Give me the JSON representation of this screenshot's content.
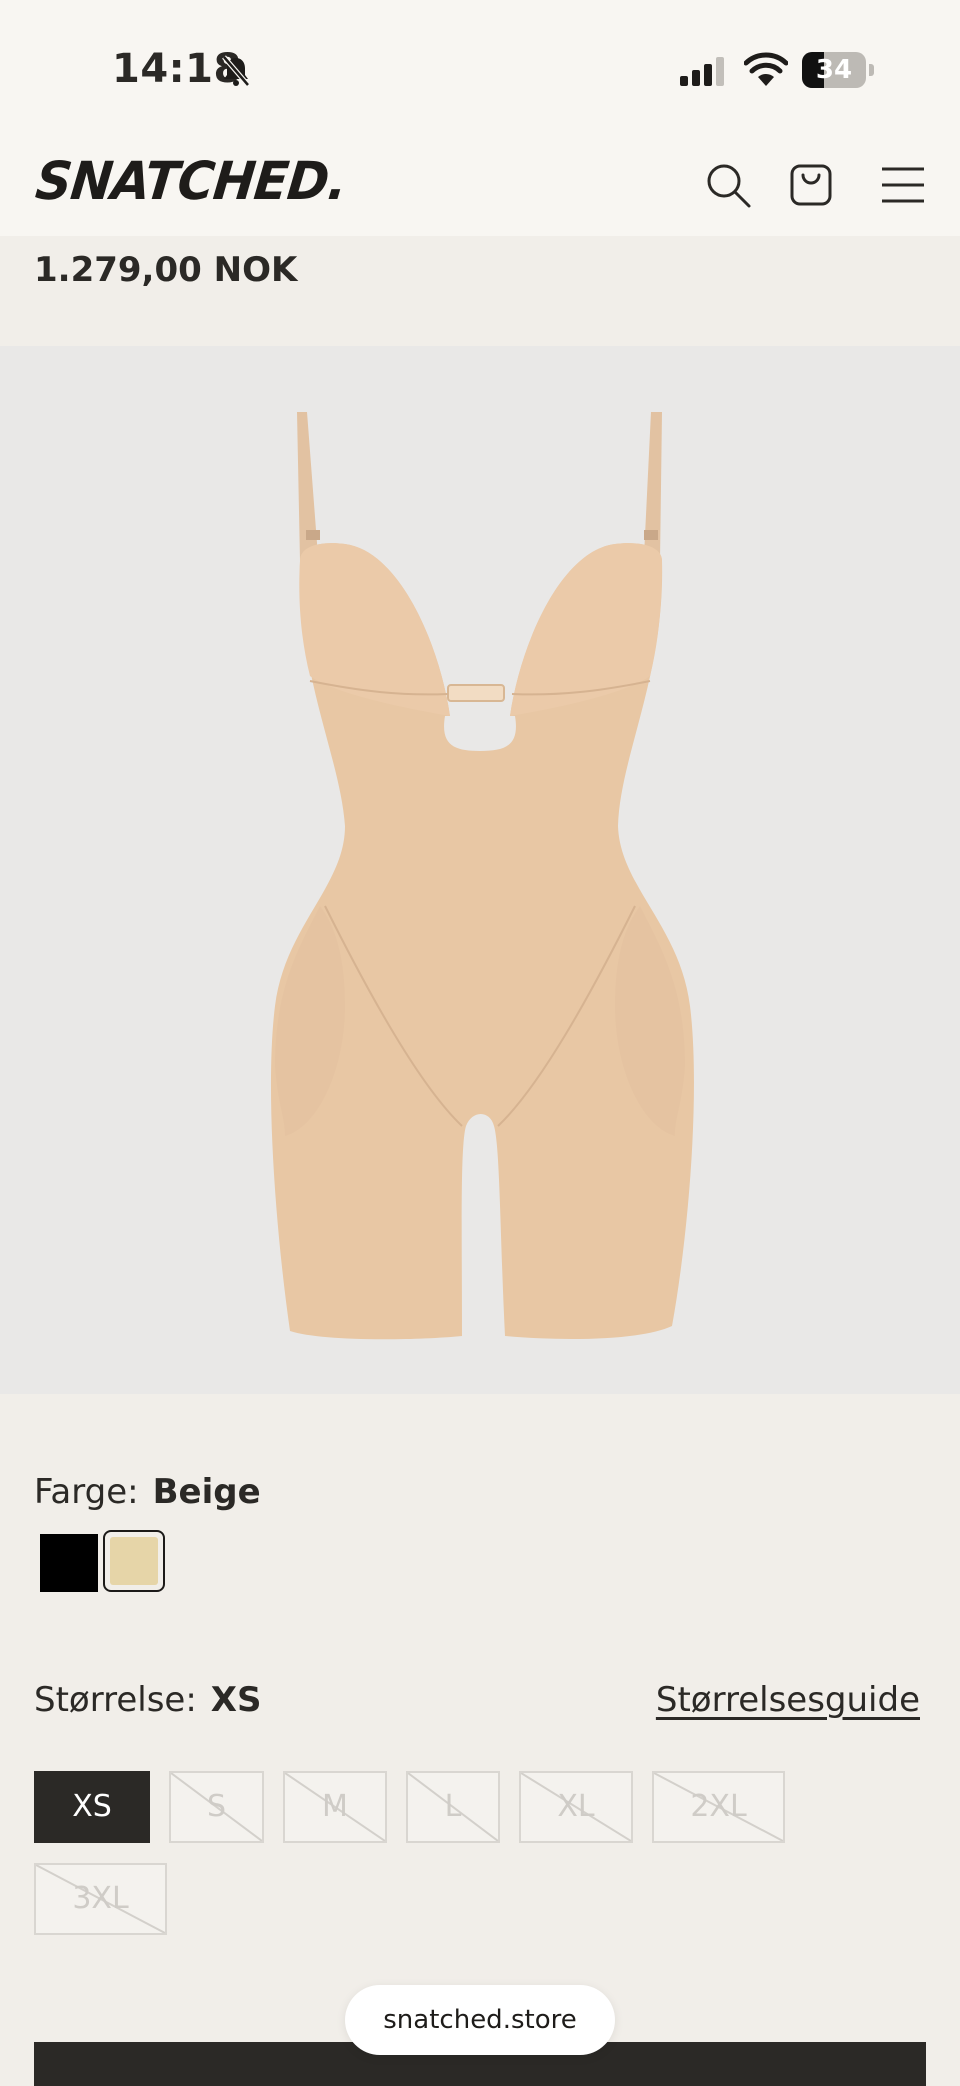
{
  "status_bar": {
    "time": "14:18",
    "battery_percent": 34,
    "battery_label": "34"
  },
  "header": {
    "logo": "SNATCHED.",
    "icons": [
      "search-icon",
      "bag-icon",
      "menu-icon"
    ]
  },
  "product": {
    "price": "1.279,00 NOK",
    "image_alt": "beige bodysuit"
  },
  "color": {
    "label": "Farge:",
    "selected": "Beige",
    "swatches": [
      {
        "name": "black",
        "hex": "#000000"
      },
      {
        "name": "beige",
        "hex": "#e6d5a8"
      }
    ]
  },
  "size": {
    "label": "Størrelse:",
    "selected": "XS",
    "guide_link": "Størrelsesguide",
    "options": [
      {
        "label": "XS",
        "available": true
      },
      {
        "label": "S",
        "available": false
      },
      {
        "label": "M",
        "available": false
      },
      {
        "label": "L",
        "available": false
      },
      {
        "label": "XL",
        "available": false
      },
      {
        "label": "2XL",
        "available": false
      },
      {
        "label": "3XL",
        "available": false
      }
    ]
  },
  "browser": {
    "url": "snatched.store"
  },
  "colors": {
    "background": "#f1eee9",
    "header_bg": "#f8f6f2",
    "dark": "#2b2926",
    "product_bg": "#e9e8e7"
  }
}
